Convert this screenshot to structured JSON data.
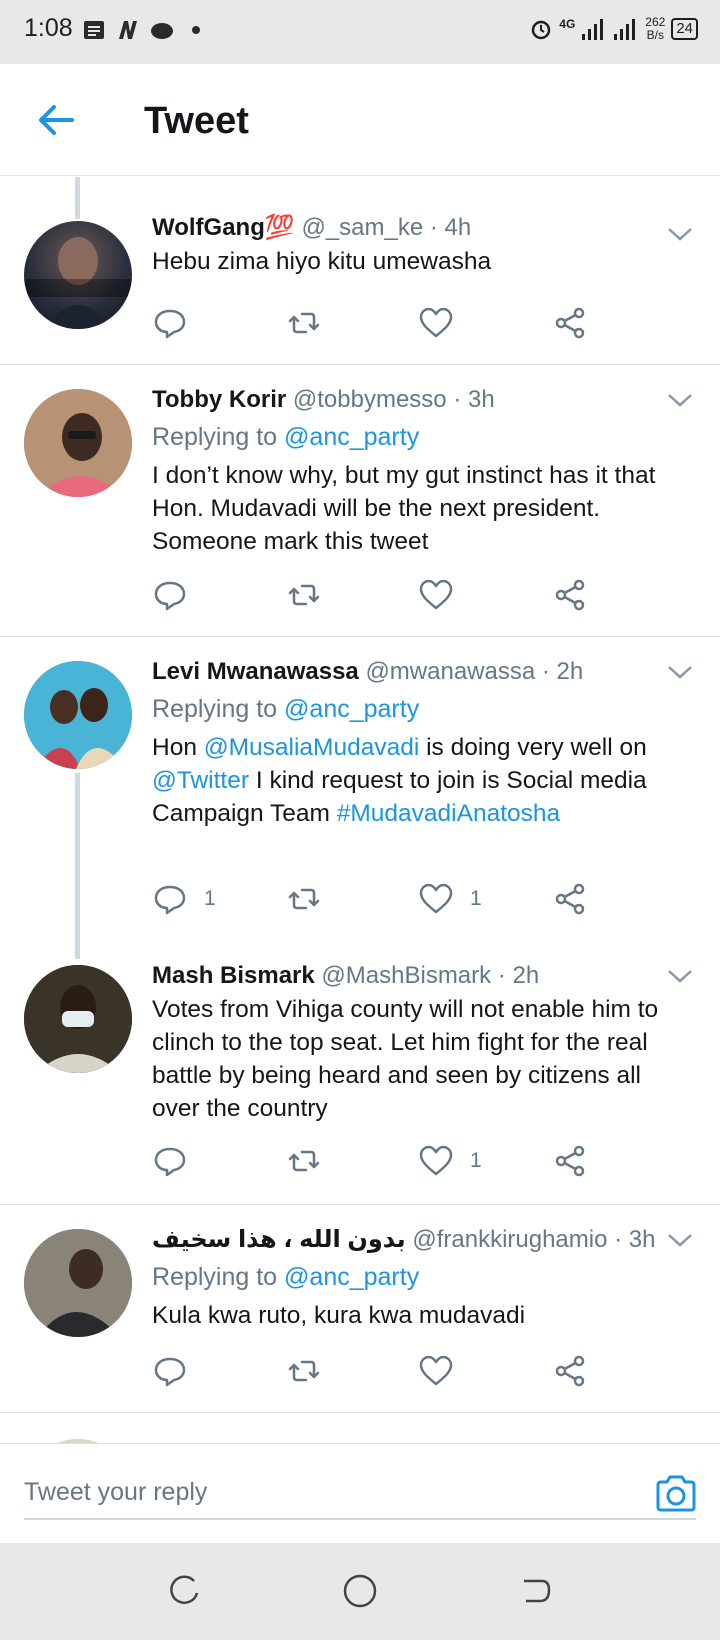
{
  "status_bar": {
    "time": "1:08",
    "net": "4G",
    "speed_top": "262",
    "speed_bottom": "B/s",
    "battery": "24"
  },
  "header": {
    "title": "Tweet"
  },
  "tweets": [
    {
      "name": "WolfGang💯",
      "handle": "@_sam_ke",
      "time": "· 4h",
      "reply_to": "",
      "body": "Hebu zima hiyo kitu umewasha",
      "replies": "",
      "likes": ""
    },
    {
      "name": "Tobby Korir",
      "handle": "@tobbymesso",
      "time": "· 3h",
      "reply_prefix": "Replying to",
      "reply_to": "@anc_party",
      "body": "I don’t know why, but my gut instinct has it that Hon. Mudavadi will be the next president. Someone mark this tweet",
      "replies": "",
      "likes": ""
    },
    {
      "name": "Levi Mwanawassa",
      "handle": "@mwanawassa",
      "time": "· 2h",
      "reply_prefix": "Replying to",
      "reply_to": "@anc_party",
      "body_parts": [
        "Hon ",
        "@MusaliaMudavadi",
        " is doing very well on ",
        "@Twitter",
        " I kind request to join is Social media Campaign Team ",
        "#MudavadiAnatosha"
      ],
      "replies": "1",
      "likes": "1"
    },
    {
      "name": "Mash Bismark",
      "handle": "@MashBismark",
      "time": "· 2h",
      "reply_to": "",
      "body": "Votes from Vihiga county will not enable him to clinch to the top seat. Let him fight for the real battle by being heard and seen by citizens all over the country",
      "replies": "",
      "likes": "1"
    },
    {
      "name": "بدون الله ، هذا سخيف",
      "handle": "@frankkirughamio",
      "time": "· 3h",
      "reply_prefix": "Replying to",
      "reply_to": "@anc_party",
      "body": "Kula kwa ruto, kura kwa mudavadi",
      "replies": "",
      "likes": ""
    }
  ],
  "reply_bar": {
    "placeholder": "Tweet your reply"
  },
  "colors": {
    "accent": "#1b95e0",
    "muted": "#657786",
    "text": "#14171a"
  }
}
